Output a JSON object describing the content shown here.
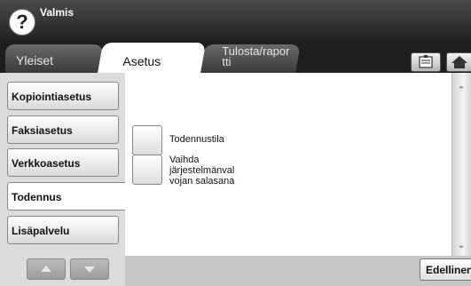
{
  "header": {
    "status": "Valmis",
    "help_icon": "question-icon",
    "help_symbol": "?"
  },
  "tabs": [
    {
      "label": "Yleiset"
    },
    {
      "label": "Asetus",
      "selected": true
    },
    {
      "label": "Tulosta/rapor\ntti"
    }
  ],
  "toolbar": {
    "icons": [
      "document-icon",
      "home-icon"
    ]
  },
  "sidebar": {
    "items": [
      {
        "label": "Kopiointiasetus"
      },
      {
        "label": "Faksiasetus"
      },
      {
        "label": "Verkkoasetus"
      },
      {
        "label": "Todennus",
        "selected": true
      },
      {
        "label": "Lisäpalvelu"
      }
    ]
  },
  "content": {
    "options": [
      {
        "label": "Todennustila"
      },
      {
        "label": "Vaihda\njärjestelmänval\nvojan salasana"
      }
    ]
  },
  "footer": {
    "back_label": "Edellinen"
  },
  "colors": {
    "topbar": "#2b2b2b",
    "sidebar": "#dcdcdc",
    "bottombar": "#c8c8c8"
  }
}
